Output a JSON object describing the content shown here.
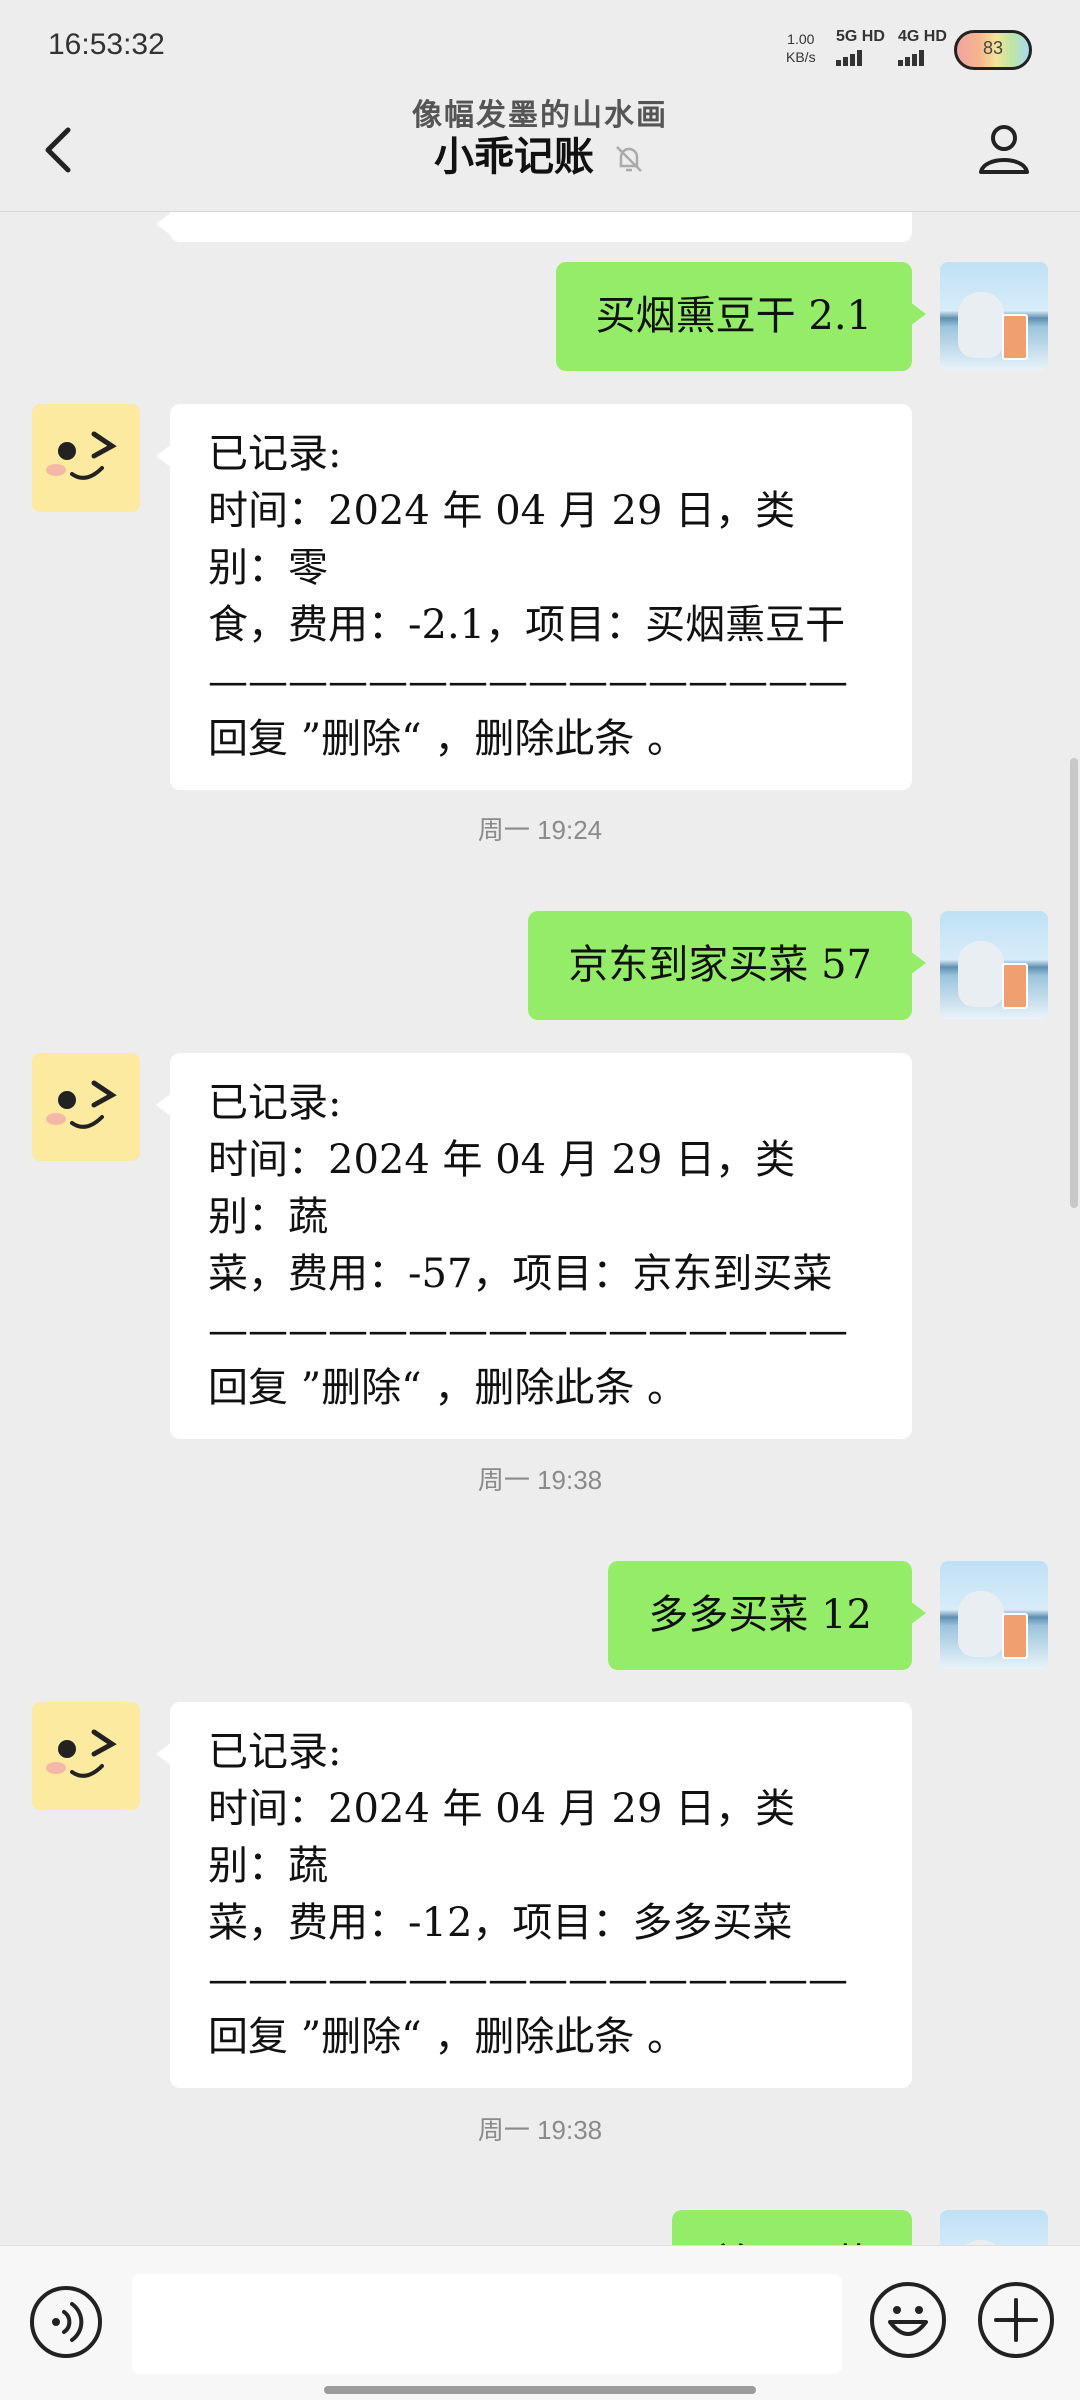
{
  "status_bar": {
    "time": "16:53:32",
    "net_speed": "1.00",
    "net_unit": "KB/s",
    "signal_1": "5G HD",
    "signal_2": "4G HD",
    "battery": "83"
  },
  "header": {
    "subtitle": "像幅发墨的山水画",
    "title": "小乖记账",
    "icons": [
      "back-arrow-icon",
      "mute-bell-icon",
      "profile-icon"
    ]
  },
  "messages": [
    {
      "type": "outgoing",
      "text": "买烟熏豆干 2.1"
    },
    {
      "type": "incoming",
      "lines": [
        "已记录:",
        "时间：2024 年 04 月 29 日，类别：零",
        "食，费用：-2.1，项目：买烟熏豆干",
        "————————————————",
        "回复 ”删除“ ，删除此条 。"
      ]
    },
    {
      "type": "timestamp",
      "text": "周一 19:24"
    },
    {
      "type": "outgoing",
      "text": "京东到家买菜 57"
    },
    {
      "type": "incoming",
      "lines": [
        "已记录:",
        "时间：2024 年 04 月 29 日，类别：蔬",
        "菜，费用：-57，项目：京东到买菜",
        "————————————————",
        "回复 ”删除“ ，删除此条 。"
      ]
    },
    {
      "type": "timestamp",
      "text": "周一 19:38"
    },
    {
      "type": "outgoing",
      "text": "多多买菜 12"
    },
    {
      "type": "incoming",
      "lines": [
        "已记录:",
        "时间：2024 年 04 月 29 日，类别：蔬",
        "菜，费用：-12，项目：多多买菜",
        "————————————————",
        "回复 ”删除“ ，删除此条 。"
      ]
    },
    {
      "type": "timestamp",
      "text": "周一 19:38"
    },
    {
      "type": "outgoing",
      "text": "美团买菜"
    }
  ],
  "input_bar": {
    "placeholder": "",
    "icons": [
      "voice-icon",
      "emoji-icon",
      "plus-icon"
    ]
  },
  "colors": {
    "background": "#ededed",
    "outgoing_bubble": "#95ec69",
    "incoming_bubble": "#ffffff"
  }
}
